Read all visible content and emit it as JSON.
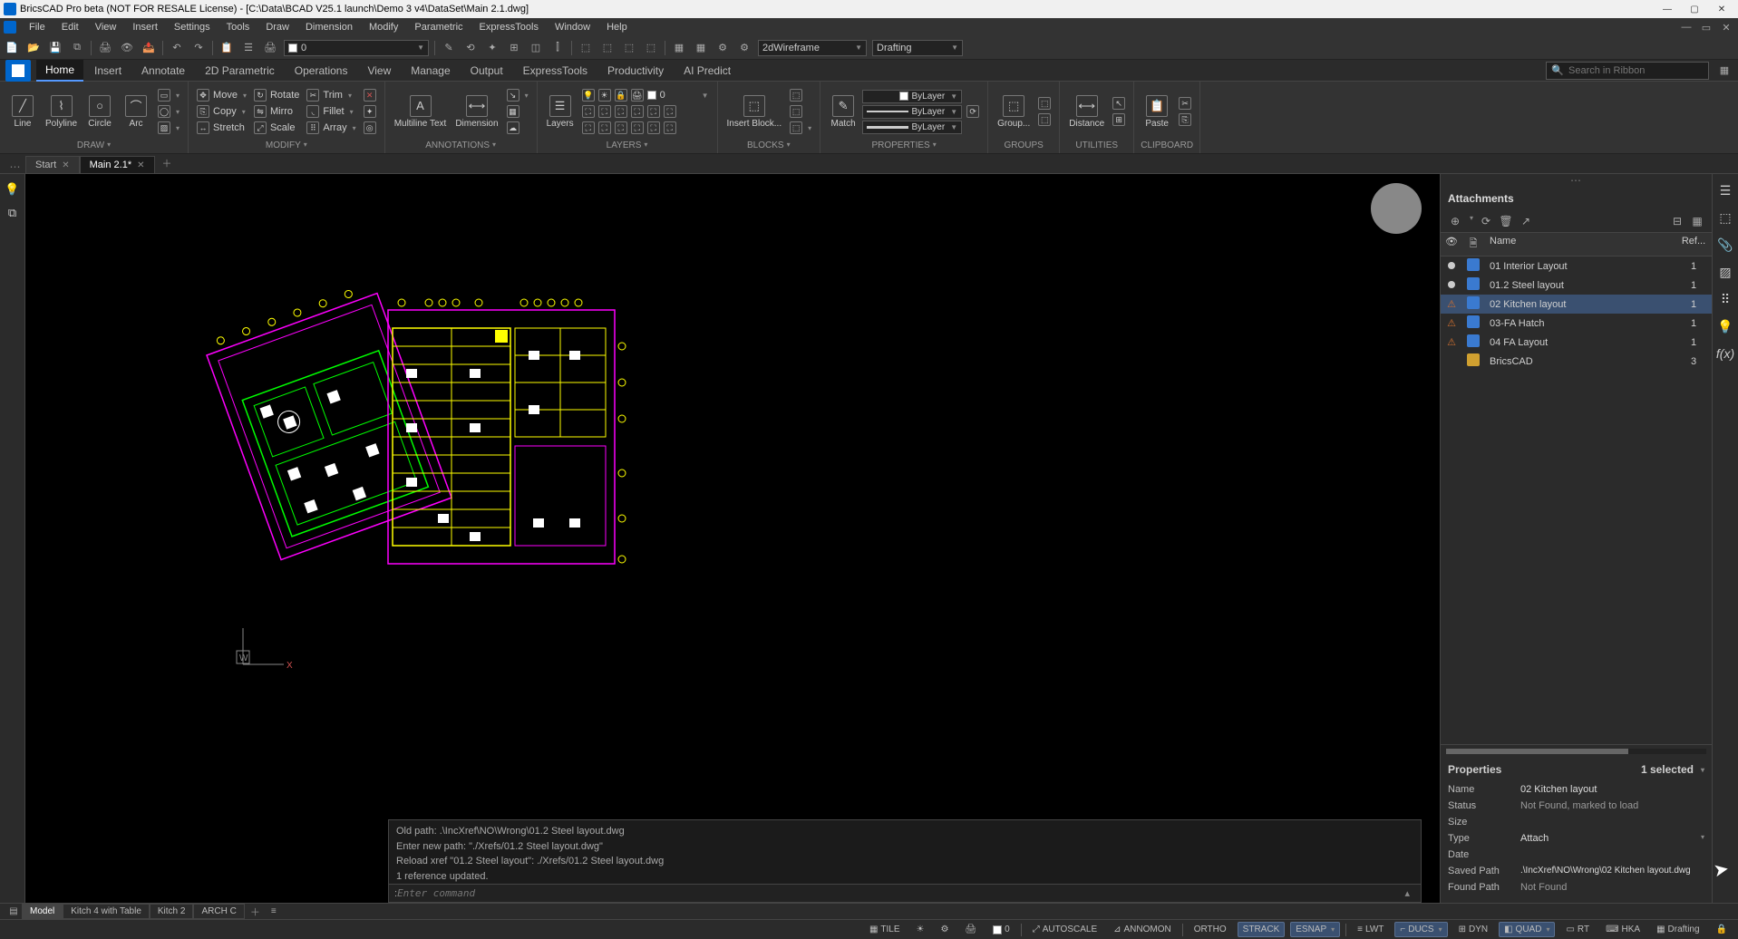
{
  "title": "BricsCAD Pro beta (NOT FOR RESALE License) - [C:\\Data\\BCAD V25.1 launch\\Demo 3 v4\\DataSet\\Main 2.1.dwg]",
  "menubar": [
    "File",
    "Edit",
    "View",
    "Insert",
    "Settings",
    "Tools",
    "Draw",
    "Dimension",
    "Modify",
    "Parametric",
    "ExpressTools",
    "Window",
    "Help"
  ],
  "quicktoolbar": {
    "layer_value": "0",
    "viewstyle": "2dWireframe",
    "workspace": "Drafting"
  },
  "ribbon_tabs": [
    "Home",
    "Insert",
    "Annotate",
    "2D Parametric",
    "Operations",
    "View",
    "Manage",
    "Output",
    "ExpressTools",
    "Productivity",
    "AI Predict"
  ],
  "ribbon_active": "Home",
  "search_placeholder": "Search in Ribbon",
  "draw": {
    "line": "Line",
    "polyline": "Polyline",
    "circle": "Circle",
    "arc": "Arc",
    "label": "DRAW"
  },
  "modify": {
    "move": "Move",
    "rotate": "Rotate",
    "trim": "Trim",
    "copy": "Copy",
    "mirror": "Mirro",
    "fillet": "Fillet",
    "stretch": "Stretch",
    "scale": "Scale",
    "array": "Array",
    "label": "MODIFY"
  },
  "annotations": {
    "mtext": "Multiline Text",
    "dim": "Dimension",
    "label": "ANNOTATIONS"
  },
  "layers": {
    "btn": "Layers",
    "combo": "0",
    "label": "LAYERS"
  },
  "block": {
    "insert": "Insert Block...",
    "label": "BLOCKS"
  },
  "properties": {
    "match": "Match",
    "bylayer": "ByLayer",
    "label": "PROPERTIES"
  },
  "groups": {
    "group": "Group...",
    "label": "GROUPS"
  },
  "utilities": {
    "distance": "Distance",
    "label": "UTILITIES"
  },
  "clipboard": {
    "paste": "Paste",
    "label": "CLIPBOARD"
  },
  "doctabs": {
    "t0": "Start",
    "t1": "Main 2.1*"
  },
  "attachments": {
    "title": "Attachments",
    "header_name": "Name",
    "header_ref": "Ref...",
    "rows": [
      {
        "status": "dot",
        "name": "01 Interior Layout",
        "ref": "1",
        "icon": "dwg"
      },
      {
        "status": "dot",
        "name": "01.2 Steel layout",
        "ref": "1",
        "icon": "dwg"
      },
      {
        "status": "warn",
        "name": "02 Kitchen layout",
        "ref": "1",
        "icon": "dwg",
        "selected": true
      },
      {
        "status": "warn",
        "name": "03-FA Hatch",
        "ref": "1",
        "icon": "dwg"
      },
      {
        "status": "warn",
        "name": "04 FA Layout",
        "ref": "1",
        "icon": "dwg"
      },
      {
        "status": "none",
        "name": "BricsCAD",
        "ref": "3",
        "icon": "folder"
      }
    ]
  },
  "props": {
    "title": "Properties",
    "count": "1 selected",
    "name_k": "Name",
    "name_v": "02 Kitchen layout",
    "status_k": "Status",
    "status_v": "Not Found, marked to load",
    "size_k": "Size",
    "size_v": "",
    "type_k": "Type",
    "type_v": "Attach",
    "date_k": "Date",
    "date_v": "",
    "saved_k": "Saved Path",
    "saved_v": ".\\IncXref\\NO\\Wrong\\02 Kitchen layout.dwg",
    "found_k": "Found Path",
    "found_v": "Not Found"
  },
  "cmd": {
    "l1": "Old path: .\\IncXref\\NO\\Wrong\\01.2 Steel layout.dwg",
    "l2": "Enter new path: \"./Xrefs/01.2 Steel layout.dwg\"",
    "l3": "Reload xref \"01.2 Steel layout\": ./Xrefs/01.2 Steel layout.dwg",
    "l4": "1 reference updated.",
    "prompt_prefix": ": ",
    "prompt_placeholder": "Enter command"
  },
  "layouttabs": {
    "t0": "Model",
    "t1": "Kitch 4 with Table",
    "t2": "Kitch 2",
    "t3": "ARCH C"
  },
  "statusbar": {
    "tile": "TILE",
    "autoscale": "AUTOSCALE",
    "annomon": "ANNOMON",
    "ortho": "ORTHO",
    "strack": "STRACK",
    "esnap": "ESNAP",
    "lwt": "LWT",
    "ducs": "DUCS",
    "dyn": "DYN",
    "quad": "QUAD",
    "rt": "RT",
    "hka": "HKA",
    "drafting": "Drafting",
    "layer": "0"
  },
  "ucs": {
    "w": "W",
    "x": "X"
  }
}
